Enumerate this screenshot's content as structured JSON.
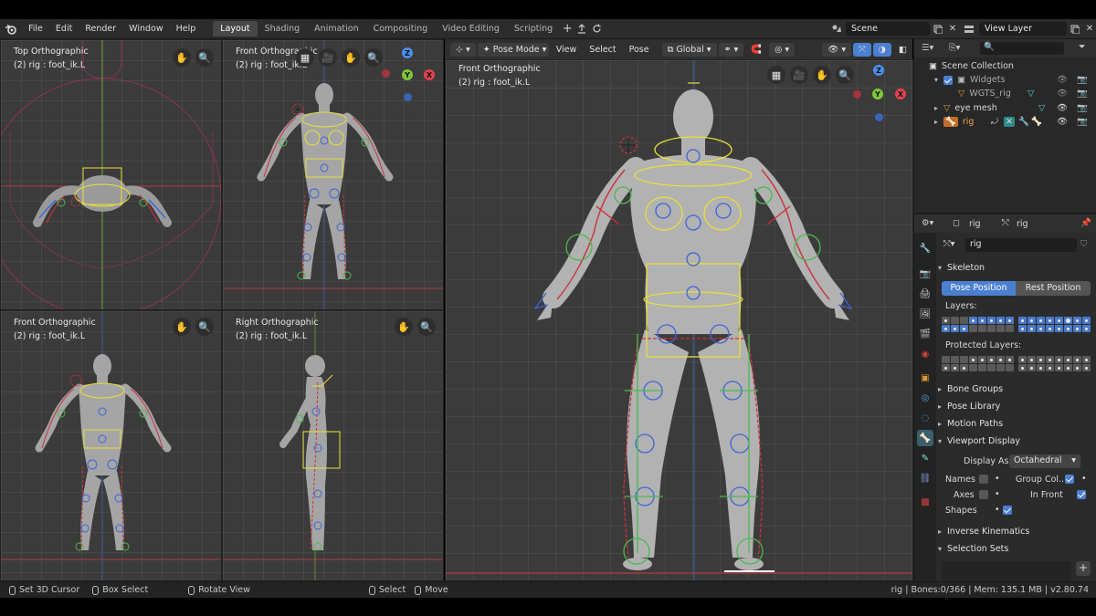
{
  "topbar": {
    "menus": [
      "File",
      "Edit",
      "Render",
      "Window",
      "Help"
    ],
    "workspaces": [
      "Layout",
      "Shading",
      "Animation",
      "Compositing",
      "Video Editing",
      "Scripting"
    ],
    "active_workspace": "Layout",
    "scene": "Scene",
    "view_layer": "View Layer"
  },
  "viewports": {
    "top_left": {
      "title": "Top Orthographic",
      "sub": "(2) rig : foot_ik.L"
    },
    "top_mid": {
      "title": "Front Orthographic",
      "sub": "(2) rig : foot_ik.L"
    },
    "bot_left": {
      "title": "Front Orthographic",
      "sub": "(2) rig : foot_ik.L"
    },
    "bot_mid": {
      "title": "Right Orthographic",
      "sub": "(2) rig : foot_ik.L"
    },
    "main": {
      "title": "Front Orthographic",
      "sub": "(2) rig : foot_ik.L"
    }
  },
  "header3d": {
    "mode": "Pose Mode",
    "view": "View",
    "select": "Select",
    "pose": "Pose",
    "orientation": "Global"
  },
  "gizmo": {
    "z": "Z",
    "y": "Y",
    "x": "X"
  },
  "outliner": {
    "search_placeholder": "",
    "rows": [
      {
        "label": "Scene Collection"
      },
      {
        "label": "Widgets"
      },
      {
        "label": "WGTS_rig"
      },
      {
        "label": "eye mesh"
      },
      {
        "label": "rig"
      }
    ]
  },
  "properties": {
    "header_object": "rig",
    "header_data": "rig",
    "data_name": "rig",
    "skeleton": "Skeleton",
    "pose_position": "Pose Position",
    "rest_position": "Rest Position",
    "layers": "Layers:",
    "protected_layers": "Protected Layers:",
    "bone_groups": "Bone Groups",
    "pose_library": "Pose Library",
    "motion_paths": "Motion Paths",
    "viewport_display": "Viewport Display",
    "display_as_label": "Display As",
    "display_as_value": "Octahedral",
    "names": "Names",
    "group_colors": "Group Col..",
    "axes": "Axes",
    "in_front": "In Front",
    "shapes": "Shapes",
    "inverse_kinematics": "Inverse Kinematics",
    "selection_sets": "Selection Sets"
  },
  "status": {
    "set_cursor": "Set 3D Cursor",
    "box_select": "Box Select",
    "rotate_view": "Rotate View",
    "select": "Select",
    "move": "Move",
    "info": "rig | Bones:0/366 | Mem: 135.1 MB | v2.80.74"
  },
  "colors": {
    "accent": "#4b7fd0",
    "axis_x": "#e3414e",
    "axis_y": "#7fc73a",
    "axis_z": "#4a8ef0",
    "bone_yellow": "#e8e03a",
    "bone_red": "#c8323c",
    "bone_green": "#4cb84c",
    "bone_blue": "#3b63d9"
  }
}
